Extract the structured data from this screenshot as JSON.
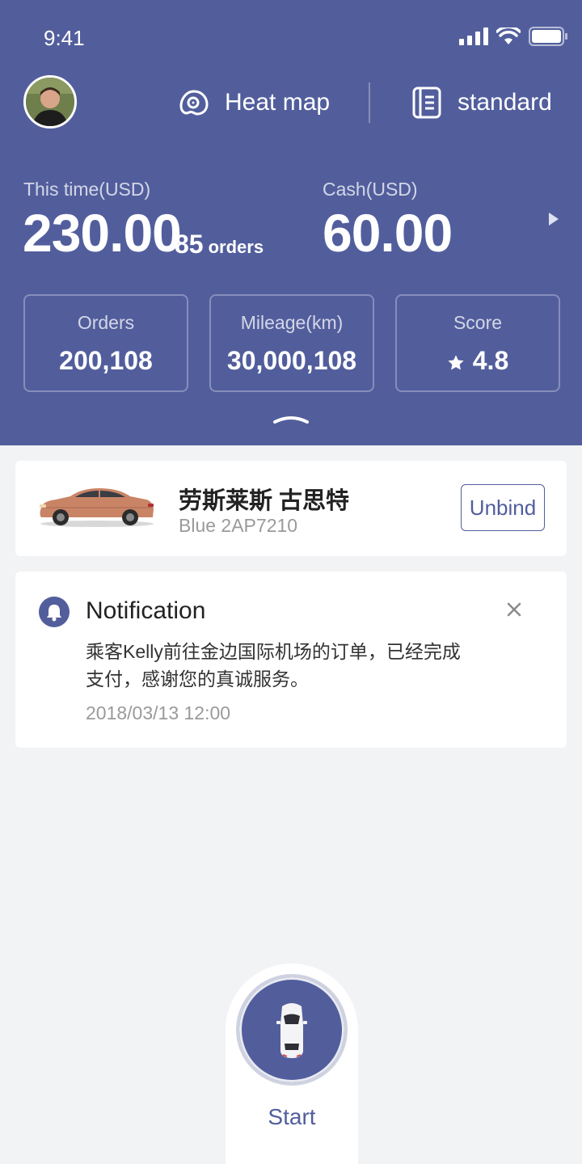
{
  "status_bar": {
    "time": "9:41"
  },
  "header": {
    "heatmap_label": "Heat map",
    "standard_label": "standard"
  },
  "earnings": {
    "this_time_label": "This time(USD)",
    "this_time_amount": "230.00",
    "orders_count": "85",
    "orders_unit": "orders",
    "cash_label": "Cash(USD)",
    "cash_amount": "60.00"
  },
  "stats": [
    {
      "label": "Orders",
      "value": "200,108"
    },
    {
      "label": "Mileage(km)",
      "value": "30,000,108"
    },
    {
      "label": "Score",
      "value": "4.8"
    }
  ],
  "car": {
    "name": "劳斯莱斯 古思特",
    "plate": "Blue 2AP7210",
    "unbind_label": "Unbind"
  },
  "notification": {
    "title": "Notification",
    "body": "乘客Kelly前往金边国际机场的订单，已经完成支付，感谢您的真诚服务。",
    "time": "2018/03/13 12:00"
  },
  "start": {
    "label": "Start"
  },
  "colors": {
    "brand": "#525e9c",
    "background": "#f2f3f5",
    "card": "#ffffff"
  }
}
